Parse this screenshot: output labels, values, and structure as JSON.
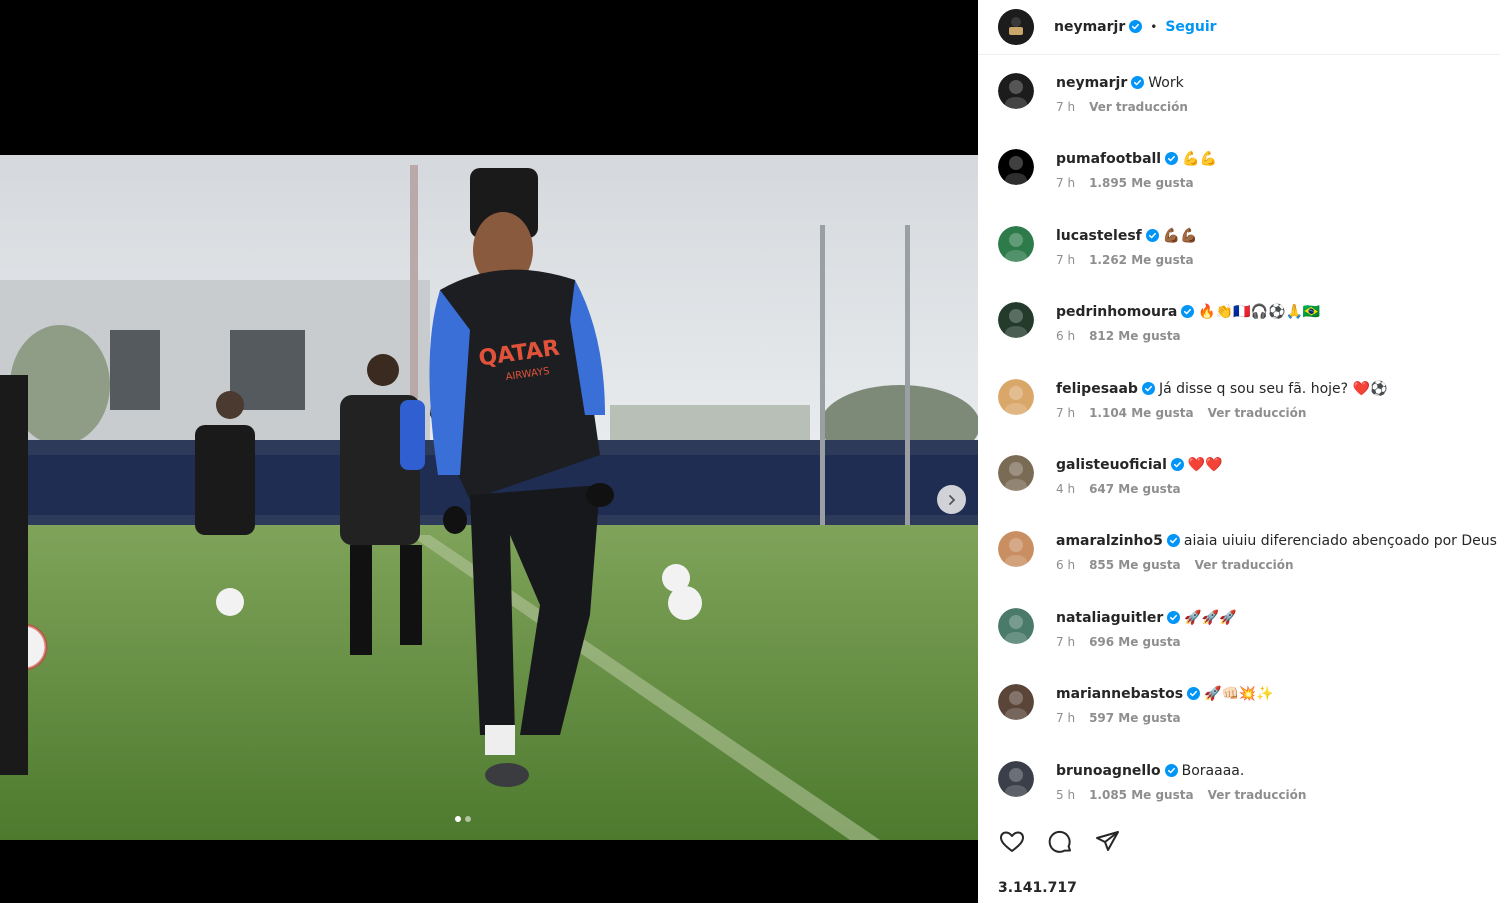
{
  "header": {
    "username": "neymarjr",
    "separator": "•",
    "follow_label": "Seguir"
  },
  "comments": [
    {
      "user": "neymarjr",
      "text": "Work",
      "time": "7 h",
      "likes": "",
      "translate": "Ver traducción",
      "avatar_color": "#1c1c1c"
    },
    {
      "user": "pumafootball",
      "text": "💪💪",
      "time": "7 h",
      "likes": "1.895 Me gusta",
      "translate": "",
      "avatar_color": "#000000"
    },
    {
      "user": "lucastelesf",
      "text": "💪🏾💪🏾",
      "time": "7 h",
      "likes": "1.262 Me gusta",
      "translate": "",
      "avatar_color": "#2d7a4a"
    },
    {
      "user": "pedrinhomoura",
      "text": "🔥👏🇫🇷🎧⚽🙏🇧🇷",
      "time": "6 h",
      "likes": "812 Me gusta",
      "translate": "",
      "avatar_color": "#243b2c"
    },
    {
      "user": "felipesaab",
      "text": "Já disse q sou seu fã. hoje? ❤️⚽",
      "time": "7 h",
      "likes": "1.104 Me gusta",
      "translate": "Ver traducción",
      "avatar_color": "#d9a76a"
    },
    {
      "user": "galisteuoficial",
      "text": "❤️❤️",
      "time": "4 h",
      "likes": "647 Me gusta",
      "translate": "",
      "avatar_color": "#7a6b55"
    },
    {
      "user": "amaralzinho5",
      "text": "aiaia uiuiu diferenciado abençoado por Deus",
      "time": "6 h",
      "likes": "855 Me gusta",
      "translate": "Ver traducción",
      "avatar_color": "#c98e61"
    },
    {
      "user": "nataliaguitler",
      "text": "🚀🚀🚀",
      "time": "7 h",
      "likes": "696 Me gusta",
      "translate": "",
      "avatar_color": "#4a7a6a"
    },
    {
      "user": "mariannebastos",
      "text": "🚀👊🏻💥✨",
      "time": "7 h",
      "likes": "597 Me gusta",
      "translate": "",
      "avatar_color": "#5a4538"
    },
    {
      "user": "brunoagnello",
      "text": "Boraaaa.",
      "time": "5 h",
      "likes": "1.085 Me gusta",
      "translate": "Ver traducción",
      "avatar_color": "#3a3f4a"
    }
  ],
  "likes_total": "3.141.717",
  "photo": {
    "shirt_sponsor_line1": "QATAR",
    "shirt_sponsor_line2": "AIRWAYS"
  },
  "colors": {
    "accent": "#0095f6",
    "verified": "#0095f6",
    "text": "#262626",
    "secondary": "#8e8e8e"
  },
  "icons": [
    "verified-badge-icon",
    "chevron-right-icon",
    "heart-icon",
    "comment-icon",
    "share-icon"
  ]
}
